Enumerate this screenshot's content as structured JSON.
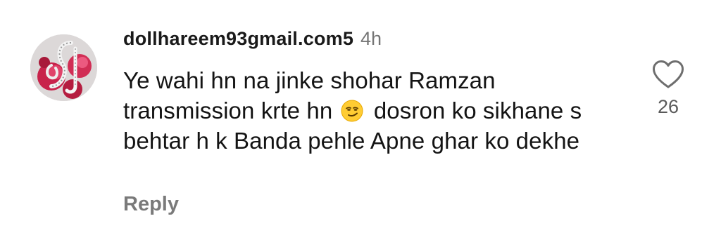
{
  "comment": {
    "username": "dollhareem93gmail.com5",
    "timestamp": "4h",
    "text_before_emoji": "Ye wahi hn na jinke shohar Ramzan transmission krte hn",
    "emoji_icon": "smirking-face-emoji",
    "text_after_emoji": "dosron ko sikhane s behtar h k Banda pehle Apne ghar ko dekhe",
    "reply_label": "Reply",
    "like_count": "26",
    "like_icon": "heart-outline-icon"
  },
  "colors": {
    "username": "#1a1a1a",
    "timestamp": "#757575",
    "reply": "#7a7a7a",
    "like_count": "#5a5a5a",
    "avatar_accent": "#c8234b"
  }
}
